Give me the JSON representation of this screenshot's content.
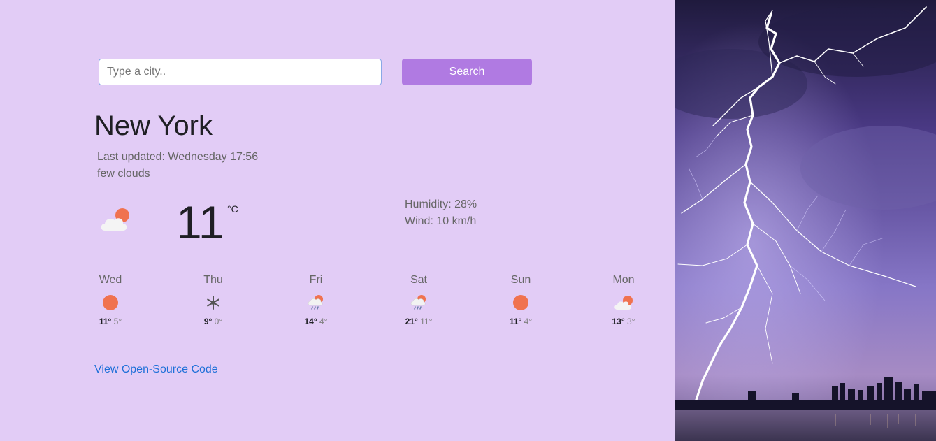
{
  "search": {
    "placeholder": "Type a city..",
    "button_label": "Search"
  },
  "current": {
    "city": "New York",
    "last_updated": "Last updated: Wednesday 17:56",
    "description": "few clouds",
    "icon": "few-clouds-icon",
    "temperature": "11",
    "unit": "°C",
    "humidity": "Humidity: 28%",
    "wind": "Wind: 10 km/h"
  },
  "forecast": [
    {
      "day": "Wed",
      "icon": "clear-sun-icon",
      "max": "11°",
      "min": "5°"
    },
    {
      "day": "Thu",
      "icon": "snow-icon",
      "max": "9°",
      "min": "0°"
    },
    {
      "day": "Fri",
      "icon": "rain-icon",
      "max": "14°",
      "min": "4°"
    },
    {
      "day": "Sat",
      "icon": "rain-icon",
      "max": "21°",
      "min": "11°"
    },
    {
      "day": "Sun",
      "icon": "clear-sun-icon",
      "max": "11°",
      "min": "4°"
    },
    {
      "day": "Mon",
      "icon": "few-clouds-icon",
      "max": "13°",
      "min": "3°"
    }
  ],
  "footer": {
    "link_label": "View Open-Source Code"
  },
  "colors": {
    "background": "#e2ccf6",
    "button": "#b07ae2",
    "link": "#1d6fd8",
    "sun": "#f0724f"
  }
}
